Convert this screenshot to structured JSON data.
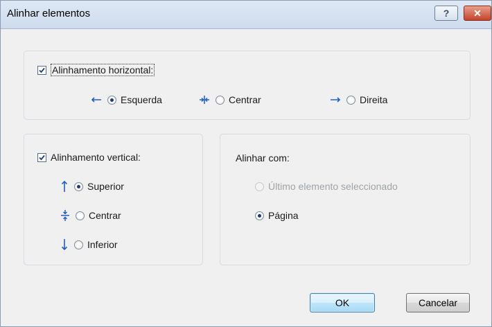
{
  "window": {
    "title": "Alinhar elementos",
    "help_glyph": "?",
    "close_glyph": "✕"
  },
  "horizontal": {
    "checkbox_label": "Alinhamento horizontal:",
    "checked": true,
    "options": [
      {
        "label": "Esquerda",
        "icon": "arrow-left-icon",
        "selected": true
      },
      {
        "label": "Centrar",
        "icon": "center-horizontal-icon",
        "selected": false
      },
      {
        "label": "Direita",
        "icon": "arrow-right-icon",
        "selected": false
      }
    ]
  },
  "vertical": {
    "checkbox_label": "Alinhamento vertical:",
    "checked": true,
    "options": [
      {
        "label": "Superior",
        "icon": "arrow-up-icon",
        "selected": true
      },
      {
        "label": "Centrar",
        "icon": "center-vertical-icon",
        "selected": false
      },
      {
        "label": "Inferior",
        "icon": "arrow-down-icon",
        "selected": false
      }
    ]
  },
  "align_with": {
    "heading": "Alinhar com:",
    "options": [
      {
        "label": "Último elemento seleccionado",
        "selected": false,
        "disabled": true
      },
      {
        "label": "Página",
        "selected": true,
        "disabled": false
      }
    ]
  },
  "buttons": {
    "ok_label": "OK",
    "cancel_label": "Cancelar"
  },
  "colors": {
    "icon_blue": "#1f5fc2",
    "close_red": "#c4432a"
  }
}
